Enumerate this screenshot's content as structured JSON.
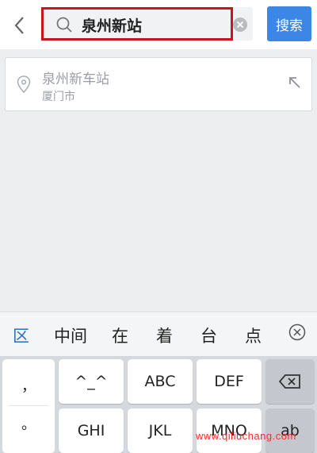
{
  "search": {
    "query": "泉州新站",
    "button_label": "搜索"
  },
  "suggestion": {
    "title": "泉州新车站",
    "subtitle": "厦门市"
  },
  "candidates": [
    "区",
    "中间",
    "在",
    "着",
    "台",
    "点"
  ],
  "keyboard": {
    "punct_top": "，",
    "punct_mid": "。",
    "row1": [
      "^_^",
      "ABC",
      "DEF"
    ],
    "row2": [
      "GHI",
      "JKL",
      "MNO",
      "ab"
    ]
  },
  "watermark": "www.qiliuchang.com",
  "colors": {
    "accent": "#3c86e6",
    "highlight_border": "#c8161d"
  },
  "icons": {
    "back": "chevron-left-icon",
    "search": "search-icon",
    "clear": "clear-icon",
    "location": "location-pin-icon",
    "fill": "arrow-up-left-icon",
    "close": "close-circle-icon",
    "backspace": "backspace-icon"
  }
}
